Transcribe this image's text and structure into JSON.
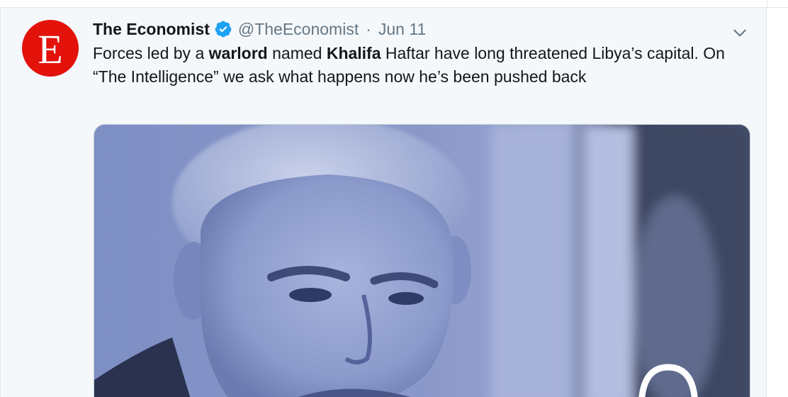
{
  "tweet": {
    "author_name": "The Economist",
    "handle": "@TheEconomist",
    "separator": "·",
    "date": "Jun 11",
    "avatar_letter": "E",
    "text": {
      "part1": "Forces led by a ",
      "bold1": "warlord",
      "part2": " named ",
      "bold2": "Khalifa",
      "part3": " Haftar have long threatened Libya’s capital. On “The Intelligence” we ask what happens now he’s been pushed back"
    }
  },
  "colors": {
    "brand_red": "#e3120b",
    "verified_blue": "#1da1f2",
    "media_tint": "#8392c6"
  },
  "icons": {
    "verified": "verified-badge-icon",
    "caret": "chevron-down-icon",
    "headphones": "headphones-icon"
  }
}
